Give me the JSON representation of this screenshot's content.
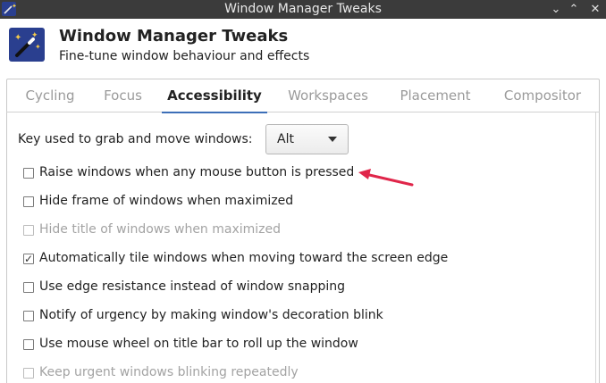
{
  "window": {
    "title": "Window Manager Tweaks"
  },
  "header": {
    "icon": "magic-wand-icon",
    "title": "Window Manager Tweaks",
    "subtitle": "Fine-tune window behaviour and effects"
  },
  "tabs": [
    {
      "label": "Cycling",
      "active": false
    },
    {
      "label": "Focus",
      "active": false
    },
    {
      "label": "Accessibility",
      "active": true
    },
    {
      "label": "Workspaces",
      "active": false
    },
    {
      "label": "Placement",
      "active": false
    },
    {
      "label": "Compositor",
      "active": false
    }
  ],
  "accessibility": {
    "grab_key_label": "Key used to grab and move windows:",
    "grab_key_value": "Alt",
    "options": [
      {
        "label": "Raise windows when any mouse button is pressed",
        "checked": false,
        "disabled": false
      },
      {
        "label": "Hide frame of windows when maximized",
        "checked": false,
        "disabled": false
      },
      {
        "label": "Hide title of windows when maximized",
        "checked": false,
        "disabled": true
      },
      {
        "label": "Automatically tile windows when moving toward the screen edge",
        "checked": true,
        "disabled": false
      },
      {
        "label": "Use edge resistance instead of window snapping",
        "checked": false,
        "disabled": false
      },
      {
        "label": "Notify of urgency by making window's decoration blink",
        "checked": false,
        "disabled": false
      },
      {
        "label": "Use mouse wheel on title bar to roll up the window",
        "checked": false,
        "disabled": false
      },
      {
        "label": "Keep urgent windows blinking repeatedly",
        "checked": false,
        "disabled": true
      }
    ]
  },
  "annotation": {
    "icon": "red-arrow-icon",
    "color": "#e0264a"
  },
  "colors": {
    "titlebar": "#3b3b3b",
    "accent": "#3d6fb8",
    "icon_bg": "#2a3f8f"
  }
}
